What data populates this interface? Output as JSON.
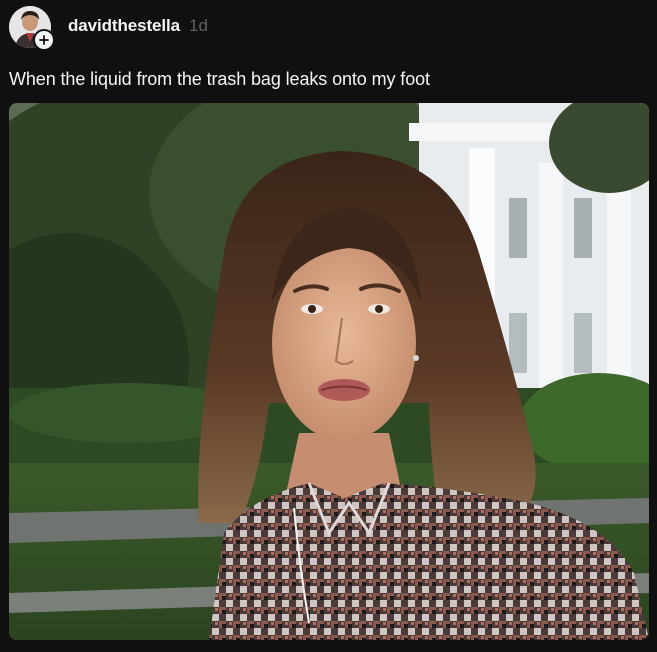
{
  "post": {
    "username": "davidthestella",
    "timestamp": "1d",
    "caption": "When the liquid from the trash bag leaks onto my foot"
  },
  "icons": {
    "follow": "plus-icon",
    "avatar": "profile-photo"
  },
  "colors": {
    "background": "#101010",
    "primary_text": "#f3f5f7",
    "secondary_text": "#616161"
  }
}
